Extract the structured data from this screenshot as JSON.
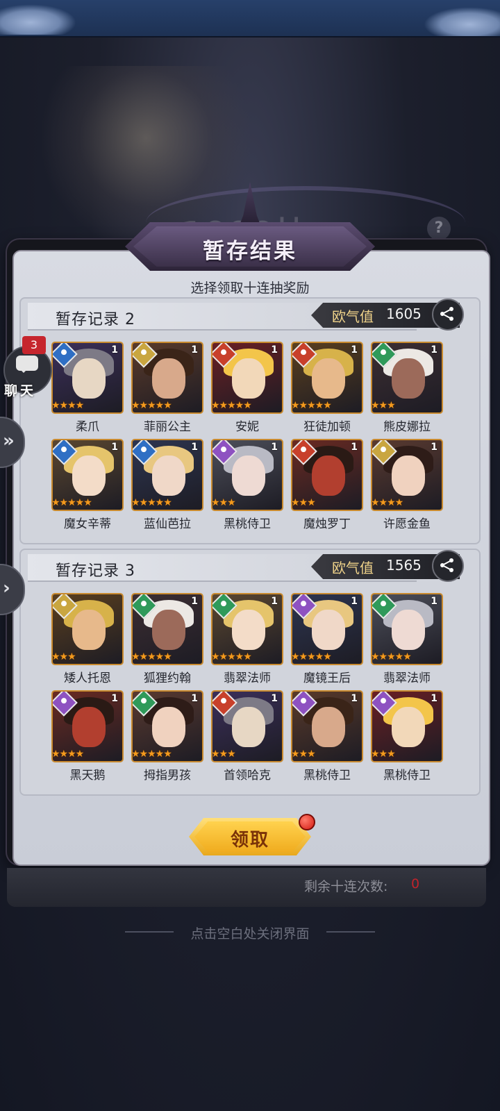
{
  "background": {
    "banner_text": "1000抽",
    "help": "?"
  },
  "chat": {
    "label": "聊天",
    "badge": "3"
  },
  "side": {
    "expand_icon": "»",
    "next_icon": "›"
  },
  "dialog": {
    "title": "暂存结果",
    "subtitle": "选择领取十连抽奖励",
    "claim_label": "领取",
    "remaining_label": "剩余十连次数:",
    "remaining_value": "0",
    "close_hint": "点击空白处关闭界面"
  },
  "records": [
    {
      "title": "暂存记录 2",
      "luck_label": "欧气值",
      "luck_value": "1605",
      "heroes": [
        {
          "name": "柔爪",
          "count": "1",
          "stars": 4,
          "element": "water"
        },
        {
          "name": "菲丽公主",
          "count": "1",
          "stars": 5,
          "element": "light"
        },
        {
          "name": "安妮",
          "count": "1",
          "stars": 5,
          "element": "fire"
        },
        {
          "name": "狂徒加顿",
          "count": "1",
          "stars": 5,
          "element": "fire"
        },
        {
          "name": "熊皮娜拉",
          "count": "1",
          "stars": 3,
          "element": "nature"
        },
        {
          "name": "魔女辛蒂",
          "count": "1",
          "stars": 5,
          "element": "water"
        },
        {
          "name": "蓝仙芭拉",
          "count": "1",
          "stars": 5,
          "element": "water"
        },
        {
          "name": "黑桃侍卫",
          "count": "1",
          "stars": 3,
          "element": "dark"
        },
        {
          "name": "魔烛罗丁",
          "count": "1",
          "stars": 3,
          "element": "fire"
        },
        {
          "name": "许愿金鱼",
          "count": "1",
          "stars": 4,
          "element": "light"
        }
      ]
    },
    {
      "title": "暂存记录 3",
      "luck_label": "欧气值",
      "luck_value": "1565",
      "heroes": [
        {
          "name": "矮人托恩",
          "count": "",
          "stars": 3,
          "element": "light"
        },
        {
          "name": "狐狸约翰",
          "count": "1",
          "stars": 5,
          "element": "nature"
        },
        {
          "name": "翡翠法师",
          "count": "1",
          "stars": 5,
          "element": "nature"
        },
        {
          "name": "魔镜王后",
          "count": "1",
          "stars": 5,
          "element": "dark"
        },
        {
          "name": "翡翠法师",
          "count": "1",
          "stars": 5,
          "element": "nature"
        },
        {
          "name": "黑天鹅",
          "count": "1",
          "stars": 4,
          "element": "dark"
        },
        {
          "name": "拇指男孩",
          "count": "1",
          "stars": 5,
          "element": "nature"
        },
        {
          "name": "首领哈克",
          "count": "1",
          "stars": 3,
          "element": "fire"
        },
        {
          "name": "黑桃侍卫",
          "count": "1",
          "stars": 3,
          "element": "dark"
        },
        {
          "name": "黑桃侍卫",
          "count": "1",
          "stars": 3,
          "element": "dark"
        }
      ]
    }
  ],
  "element_colors": {
    "water": "#2f6fc4",
    "light": "#c9a640",
    "fire": "#c8402b",
    "nature": "#2f9a5a",
    "dark": "#8e52c1"
  }
}
